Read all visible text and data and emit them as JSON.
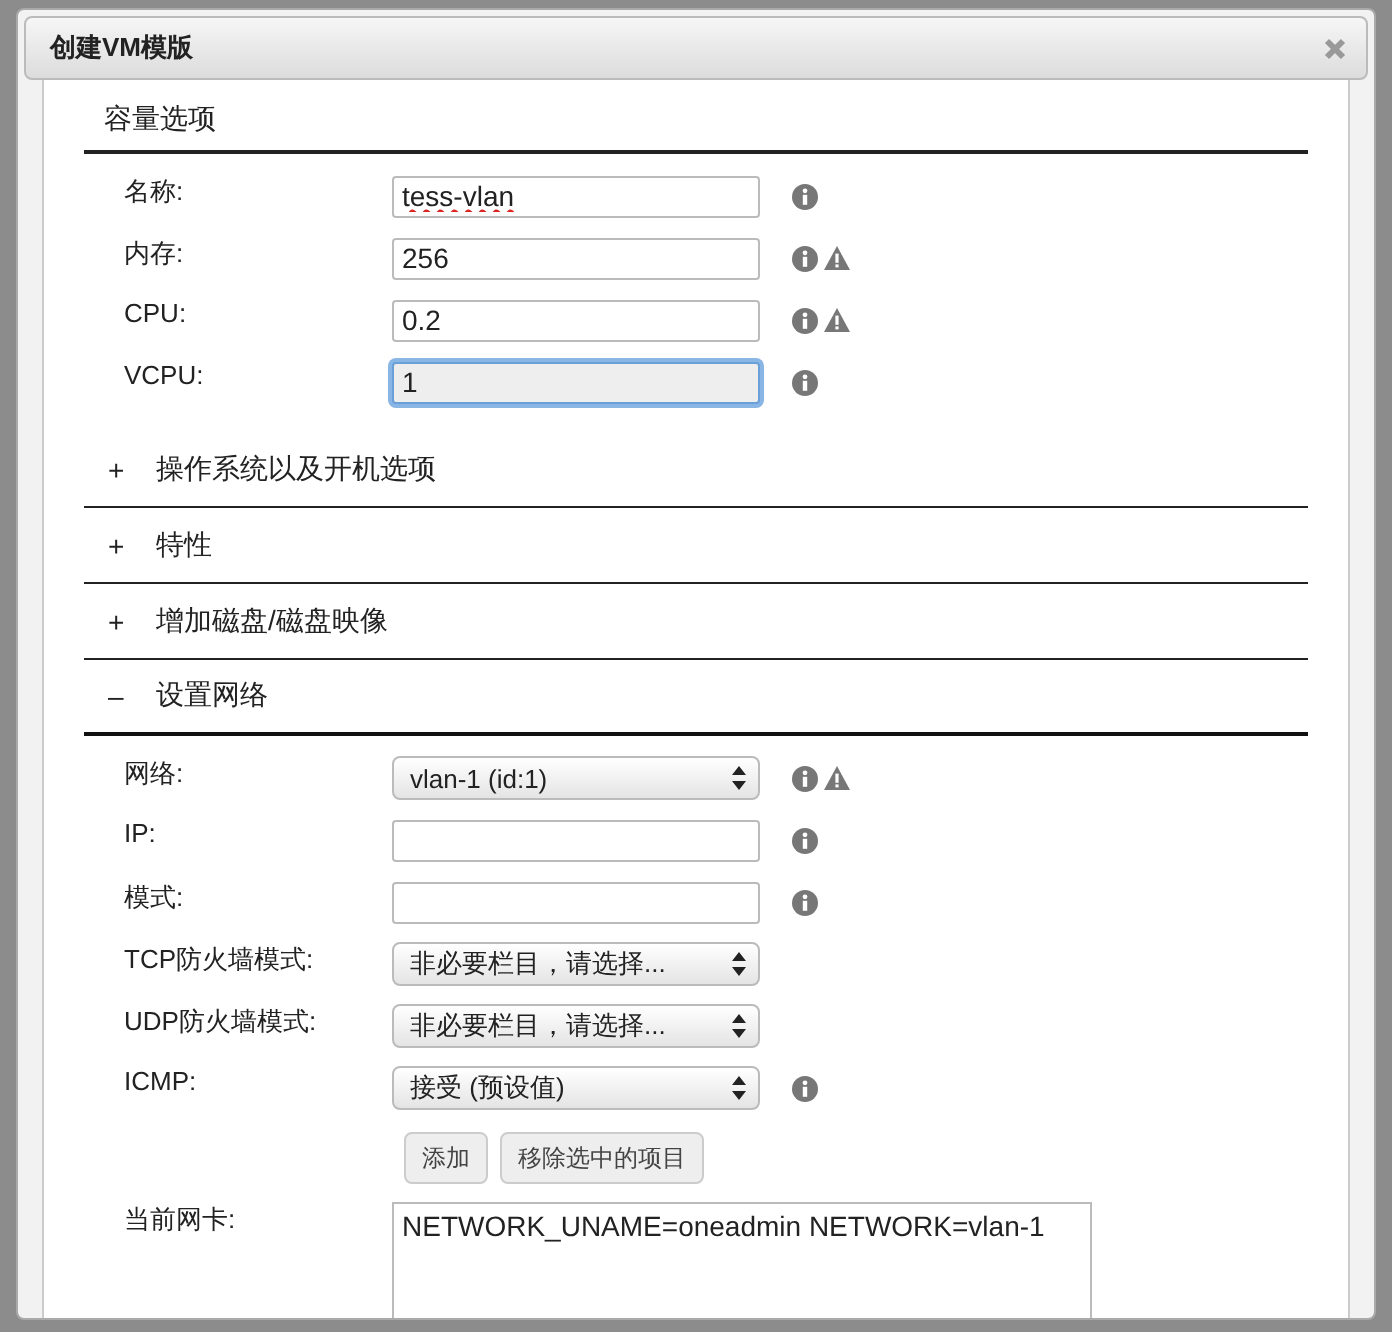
{
  "dialog": {
    "title": "创建VM模版"
  },
  "sections": [
    {
      "kind": "form",
      "title": "容量选项",
      "fields": [
        {
          "label": "名称:",
          "kind": "input",
          "value": "tess-vlan",
          "info": true,
          "warning": false,
          "focused": false,
          "spell_error": true
        },
        {
          "label": "内存:",
          "kind": "input",
          "value": "256",
          "info": true,
          "warning": true,
          "focused": false,
          "spell_error": false
        },
        {
          "label": "CPU:",
          "kind": "input",
          "value": "0.2",
          "info": true,
          "warning": true,
          "focused": false,
          "spell_error": false
        },
        {
          "label": "VCPU:",
          "kind": "input",
          "value": "1",
          "info": true,
          "warning": false,
          "focused": true,
          "spell_error": false
        }
      ]
    },
    {
      "kind": "collapsible",
      "expanded": false,
      "toggle": "+",
      "title": "操作系统以及开机选项"
    },
    {
      "kind": "collapsible",
      "expanded": false,
      "toggle": "+",
      "title": "特性"
    },
    {
      "kind": "collapsible",
      "expanded": false,
      "toggle": "+",
      "title": "增加磁盘/磁盘映像"
    },
    {
      "kind": "collapsible",
      "expanded": true,
      "toggle": "–",
      "title": "设置网络",
      "fields": [
        {
          "label": "网络:",
          "kind": "select",
          "value": "vlan-1 (id:1)",
          "info": true,
          "warning": true
        },
        {
          "label": "IP:",
          "kind": "input",
          "info": true,
          "warning": false
        },
        {
          "label": "模式:",
          "kind": "input",
          "info": true,
          "warning": false
        },
        {
          "label": "TCP防火墙模式:",
          "kind": "select",
          "value": "非必要栏目，请选择...",
          "info": false,
          "warning": false
        },
        {
          "label": "UDP防火墙模式:",
          "kind": "select",
          "value": "非必要栏目，请选择...",
          "info": false,
          "warning": false
        },
        {
          "label": "ICMP:",
          "kind": "select",
          "value": "接受 (预设值)",
          "info": true,
          "warning": false
        }
      ],
      "buttons": [
        "添加",
        "移除选中的项目"
      ],
      "nic": {
        "label": "当前网卡:",
        "value": "NETWORK_UNAME=oneadmin NETWORK=vlan-1"
      }
    }
  ]
}
